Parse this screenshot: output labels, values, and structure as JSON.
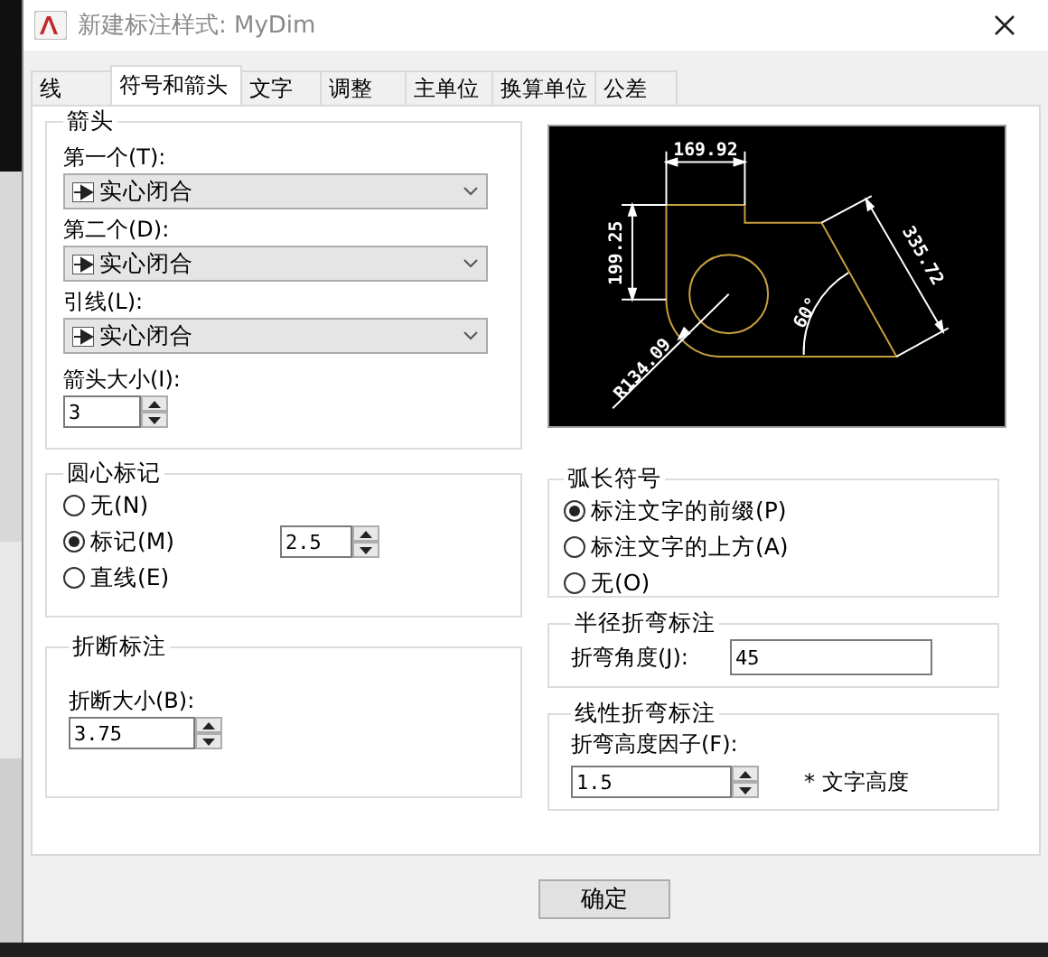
{
  "window": {
    "title": "新建标注样式: MyDim"
  },
  "tabs": [
    {
      "label": "线",
      "selected": false
    },
    {
      "label": "符号和箭头",
      "selected": true
    },
    {
      "label": "文字",
      "selected": false
    },
    {
      "label": "调整",
      "selected": false
    },
    {
      "label": "主单位",
      "selected": false
    },
    {
      "label": "换算单位",
      "selected": false
    },
    {
      "label": "公差",
      "selected": false
    }
  ],
  "arrowheads": {
    "title": "箭头",
    "fields": [
      {
        "label": "第一个(T):",
        "value": "实心闭合"
      },
      {
        "label": "第二个(D):",
        "value": "实心闭合"
      },
      {
        "label": "引线(L):",
        "value": "实心闭合"
      }
    ],
    "size": {
      "label": "箭头大小(I):",
      "value": "3"
    }
  },
  "center_marks": {
    "title": "圆心标记",
    "options": [
      {
        "label": "无(N)",
        "selected": false
      },
      {
        "label": "标记(M)",
        "selected": true
      },
      {
        "label": "直线(E)",
        "selected": false
      }
    ],
    "size": {
      "value": "2.5"
    }
  },
  "dimension_break": {
    "title": "折断标注",
    "size": {
      "label": "折断大小(B):",
      "value": "3.75"
    }
  },
  "preview": {
    "labels": [
      "169.92",
      "199.25",
      "335.72",
      "60°",
      "R134.09"
    ]
  },
  "arc_length_symbol": {
    "title": "弧长符号",
    "options": [
      {
        "label": "标注文字的前缀(P)",
        "selected": true
      },
      {
        "label": "标注文字的上方(A)",
        "selected": false
      },
      {
        "label": "无(O)",
        "selected": false
      }
    ]
  },
  "radius_jog": {
    "title": "半径折弯标注",
    "angle": {
      "label": "折弯角度(J):",
      "value": "45"
    }
  },
  "linear_jog": {
    "title": "线性折弯标注",
    "factor": {
      "label": "折弯高度因子(F):",
      "value": "1.5"
    },
    "suffix": "* 文字高度"
  },
  "buttons": [
    "确定"
  ]
}
